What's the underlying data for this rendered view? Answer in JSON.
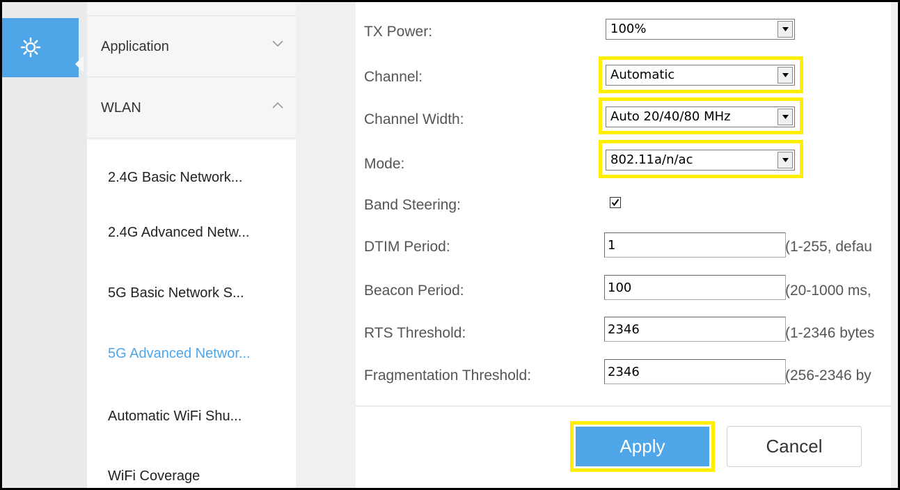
{
  "icons": {
    "settings": "gear-icon",
    "collapse_chevron": "chevron-down-icon",
    "expand_chevron": "chevron-up-icon",
    "select_arrow": "dropdown-arrow-icon",
    "check": "check-icon"
  },
  "colors": {
    "accent": "#4ea6e9",
    "highlight": "#ffee00"
  },
  "menu": {
    "sections": [
      {
        "label": "Application",
        "expanded": false
      },
      {
        "label": "WLAN",
        "expanded": true
      }
    ],
    "items": [
      {
        "label": "2.4G Basic Network..."
      },
      {
        "label": "2.4G Advanced Netw..."
      },
      {
        "label": "5G Basic Network S..."
      },
      {
        "label": "5G Advanced Networ...",
        "active": true
      },
      {
        "label": "Automatic WiFi Shu..."
      },
      {
        "label": "WiFi Coverage"
      }
    ]
  },
  "form": {
    "tx_power": {
      "label": "TX Power:",
      "value": "100%"
    },
    "channel": {
      "label": "Channel:",
      "value": "Automatic"
    },
    "channel_width": {
      "label": "Channel Width:",
      "value": "Auto 20/40/80 MHz"
    },
    "mode": {
      "label": "Mode:",
      "value": "802.11a/n/ac"
    },
    "band_steering": {
      "label": "Band Steering:",
      "checked": true
    },
    "dtim": {
      "label": "DTIM Period:",
      "value": "1",
      "hint": "(1-255, defau"
    },
    "beacon": {
      "label": "Beacon Period:",
      "value": "100",
      "hint": "(20-1000 ms,"
    },
    "rts": {
      "label": "RTS Threshold:",
      "value": "2346",
      "hint": "(1-2346 bytes"
    },
    "frag": {
      "label": "Fragmentation Threshold:",
      "value": "2346",
      "hint": "(256-2346 by"
    }
  },
  "buttons": {
    "apply": "Apply",
    "cancel": "Cancel"
  }
}
